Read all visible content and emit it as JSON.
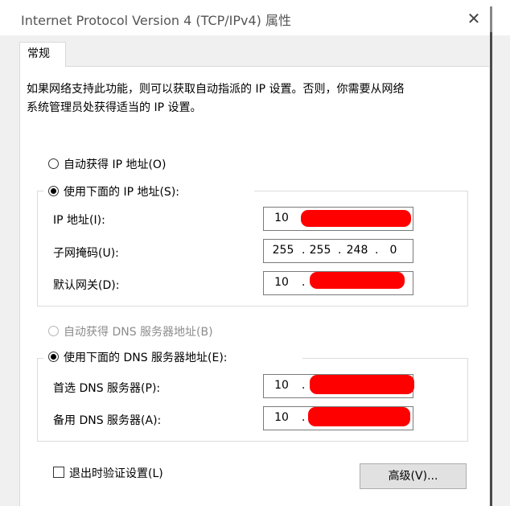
{
  "window": {
    "title": "Internet Protocol Version 4 (TCP/IPv4) 属性",
    "close_glyph": "✕"
  },
  "tabs": [
    {
      "label": "常规",
      "selected": true
    }
  ],
  "description": {
    "line1": "如果网络支持此功能，则可以获取自动指派的 IP 设置。否则，你需要从网络",
    "line2": "系统管理员处获得适当的 IP 设置。"
  },
  "ip": {
    "auto_label": "自动获得 IP 地址(O)",
    "auto_selected": false,
    "manual_label": "使用下面的 IP 地址(S):",
    "manual_selected": true,
    "address_label": "IP 地址(I):",
    "address": {
      "octet1": "10",
      "redacted": true
    },
    "subnet_label": "子网掩码(U):",
    "subnet": {
      "octet1": "255",
      "octet2": "255",
      "octet3": "248",
      "octet4": "0",
      "separator": "."
    },
    "gateway_label": "默认网关(D):",
    "gateway": {
      "octet1": "10",
      "separator": ".",
      "redacted": true
    }
  },
  "dns": {
    "auto_label": "自动获得 DNS 服务器地址(B)",
    "auto_selected": false,
    "auto_disabled": true,
    "manual_label": "使用下面的 DNS 服务器地址(E):",
    "manual_selected": true,
    "preferred_label": "首选 DNS 服务器(P):",
    "preferred": {
      "octet1": "10",
      "separator": ".",
      "redacted": true
    },
    "alternate_label": "备用 DNS 服务器(A):",
    "alternate": {
      "octet1": "10",
      "separator": ".",
      "redacted": true
    }
  },
  "validate": {
    "label": "退出时验证设置(L)",
    "checked": false
  },
  "advanced_button": "高级(V)...",
  "colors": {
    "redaction": "#ff0000",
    "dialog_bg": "#f0f0f0",
    "panel_bg": "#ffffff"
  }
}
